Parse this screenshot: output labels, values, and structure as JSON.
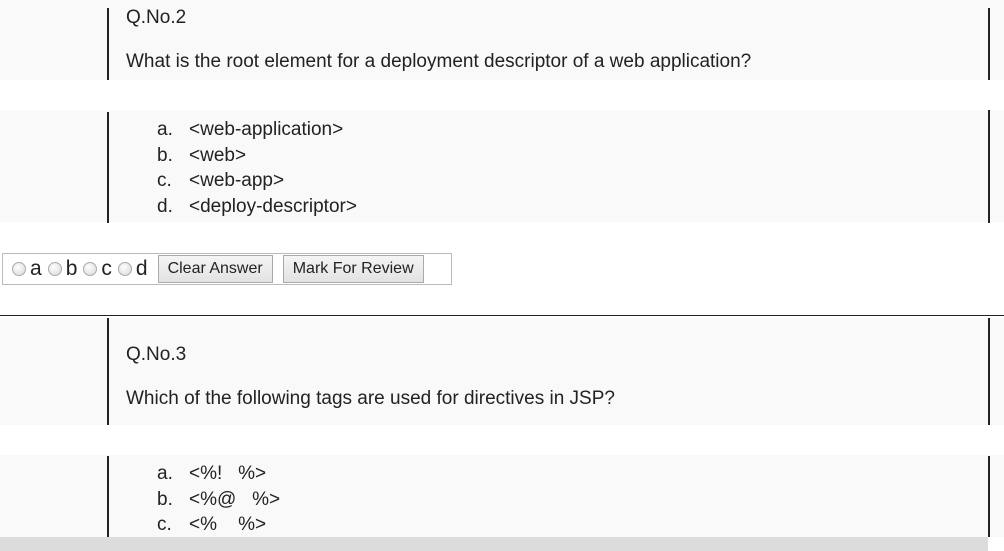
{
  "questions": [
    {
      "number": "Q.No.2",
      "text": "What is the root element for a deployment descriptor of a web application?",
      "options": [
        {
          "letter": "a.",
          "text": "<web-application>"
        },
        {
          "letter": "b.",
          "text": "<web>"
        },
        {
          "letter": "c.",
          "text": "<web-app>"
        },
        {
          "letter": "d.",
          "text": "<deploy-descriptor>"
        }
      ]
    },
    {
      "number": "Q.No.3",
      "text": "Which of the following tags are used for directives in JSP?",
      "options": [
        {
          "letter": "a.",
          "text": "<%!   %>"
        },
        {
          "letter": "b.",
          "text": "<%@   %>"
        },
        {
          "letter": "c.",
          "text": "<%    %>"
        }
      ]
    }
  ],
  "answer_bar": {
    "choices": [
      "a",
      "b",
      "c",
      "d"
    ],
    "clear_label": "Clear Answer",
    "review_label": "Mark For Review"
  }
}
